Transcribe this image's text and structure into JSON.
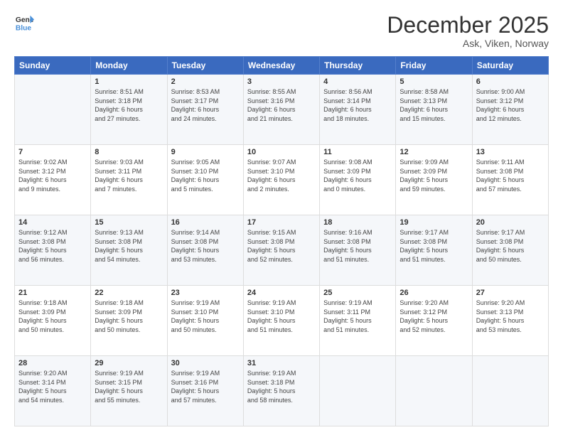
{
  "logo": {
    "line1": "General",
    "line2": "Blue"
  },
  "title": "December 2025",
  "subtitle": "Ask, Viken, Norway",
  "days_header": [
    "Sunday",
    "Monday",
    "Tuesday",
    "Wednesday",
    "Thursday",
    "Friday",
    "Saturday"
  ],
  "weeks": [
    [
      {
        "day": "",
        "info": ""
      },
      {
        "day": "1",
        "info": "Sunrise: 8:51 AM\nSunset: 3:18 PM\nDaylight: 6 hours\nand 27 minutes."
      },
      {
        "day": "2",
        "info": "Sunrise: 8:53 AM\nSunset: 3:17 PM\nDaylight: 6 hours\nand 24 minutes."
      },
      {
        "day": "3",
        "info": "Sunrise: 8:55 AM\nSunset: 3:16 PM\nDaylight: 6 hours\nand 21 minutes."
      },
      {
        "day": "4",
        "info": "Sunrise: 8:56 AM\nSunset: 3:14 PM\nDaylight: 6 hours\nand 18 minutes."
      },
      {
        "day": "5",
        "info": "Sunrise: 8:58 AM\nSunset: 3:13 PM\nDaylight: 6 hours\nand 15 minutes."
      },
      {
        "day": "6",
        "info": "Sunrise: 9:00 AM\nSunset: 3:12 PM\nDaylight: 6 hours\nand 12 minutes."
      }
    ],
    [
      {
        "day": "7",
        "info": "Sunrise: 9:02 AM\nSunset: 3:12 PM\nDaylight: 6 hours\nand 9 minutes."
      },
      {
        "day": "8",
        "info": "Sunrise: 9:03 AM\nSunset: 3:11 PM\nDaylight: 6 hours\nand 7 minutes."
      },
      {
        "day": "9",
        "info": "Sunrise: 9:05 AM\nSunset: 3:10 PM\nDaylight: 6 hours\nand 5 minutes."
      },
      {
        "day": "10",
        "info": "Sunrise: 9:07 AM\nSunset: 3:10 PM\nDaylight: 6 hours\nand 2 minutes."
      },
      {
        "day": "11",
        "info": "Sunrise: 9:08 AM\nSunset: 3:09 PM\nDaylight: 6 hours\nand 0 minutes."
      },
      {
        "day": "12",
        "info": "Sunrise: 9:09 AM\nSunset: 3:09 PM\nDaylight: 5 hours\nand 59 minutes."
      },
      {
        "day": "13",
        "info": "Sunrise: 9:11 AM\nSunset: 3:08 PM\nDaylight: 5 hours\nand 57 minutes."
      }
    ],
    [
      {
        "day": "14",
        "info": "Sunrise: 9:12 AM\nSunset: 3:08 PM\nDaylight: 5 hours\nand 56 minutes."
      },
      {
        "day": "15",
        "info": "Sunrise: 9:13 AM\nSunset: 3:08 PM\nDaylight: 5 hours\nand 54 minutes."
      },
      {
        "day": "16",
        "info": "Sunrise: 9:14 AM\nSunset: 3:08 PM\nDaylight: 5 hours\nand 53 minutes."
      },
      {
        "day": "17",
        "info": "Sunrise: 9:15 AM\nSunset: 3:08 PM\nDaylight: 5 hours\nand 52 minutes."
      },
      {
        "day": "18",
        "info": "Sunrise: 9:16 AM\nSunset: 3:08 PM\nDaylight: 5 hours\nand 51 minutes."
      },
      {
        "day": "19",
        "info": "Sunrise: 9:17 AM\nSunset: 3:08 PM\nDaylight: 5 hours\nand 51 minutes."
      },
      {
        "day": "20",
        "info": "Sunrise: 9:17 AM\nSunset: 3:08 PM\nDaylight: 5 hours\nand 50 minutes."
      }
    ],
    [
      {
        "day": "21",
        "info": "Sunrise: 9:18 AM\nSunset: 3:09 PM\nDaylight: 5 hours\nand 50 minutes."
      },
      {
        "day": "22",
        "info": "Sunrise: 9:18 AM\nSunset: 3:09 PM\nDaylight: 5 hours\nand 50 minutes."
      },
      {
        "day": "23",
        "info": "Sunrise: 9:19 AM\nSunset: 3:10 PM\nDaylight: 5 hours\nand 50 minutes."
      },
      {
        "day": "24",
        "info": "Sunrise: 9:19 AM\nSunset: 3:10 PM\nDaylight: 5 hours\nand 51 minutes."
      },
      {
        "day": "25",
        "info": "Sunrise: 9:19 AM\nSunset: 3:11 PM\nDaylight: 5 hours\nand 51 minutes."
      },
      {
        "day": "26",
        "info": "Sunrise: 9:20 AM\nSunset: 3:12 PM\nDaylight: 5 hours\nand 52 minutes."
      },
      {
        "day": "27",
        "info": "Sunrise: 9:20 AM\nSunset: 3:13 PM\nDaylight: 5 hours\nand 53 minutes."
      }
    ],
    [
      {
        "day": "28",
        "info": "Sunrise: 9:20 AM\nSunset: 3:14 PM\nDaylight: 5 hours\nand 54 minutes."
      },
      {
        "day": "29",
        "info": "Sunrise: 9:19 AM\nSunset: 3:15 PM\nDaylight: 5 hours\nand 55 minutes."
      },
      {
        "day": "30",
        "info": "Sunrise: 9:19 AM\nSunset: 3:16 PM\nDaylight: 5 hours\nand 57 minutes."
      },
      {
        "day": "31",
        "info": "Sunrise: 9:19 AM\nSunset: 3:18 PM\nDaylight: 5 hours\nand 58 minutes."
      },
      {
        "day": "",
        "info": ""
      },
      {
        "day": "",
        "info": ""
      },
      {
        "day": "",
        "info": ""
      }
    ]
  ]
}
